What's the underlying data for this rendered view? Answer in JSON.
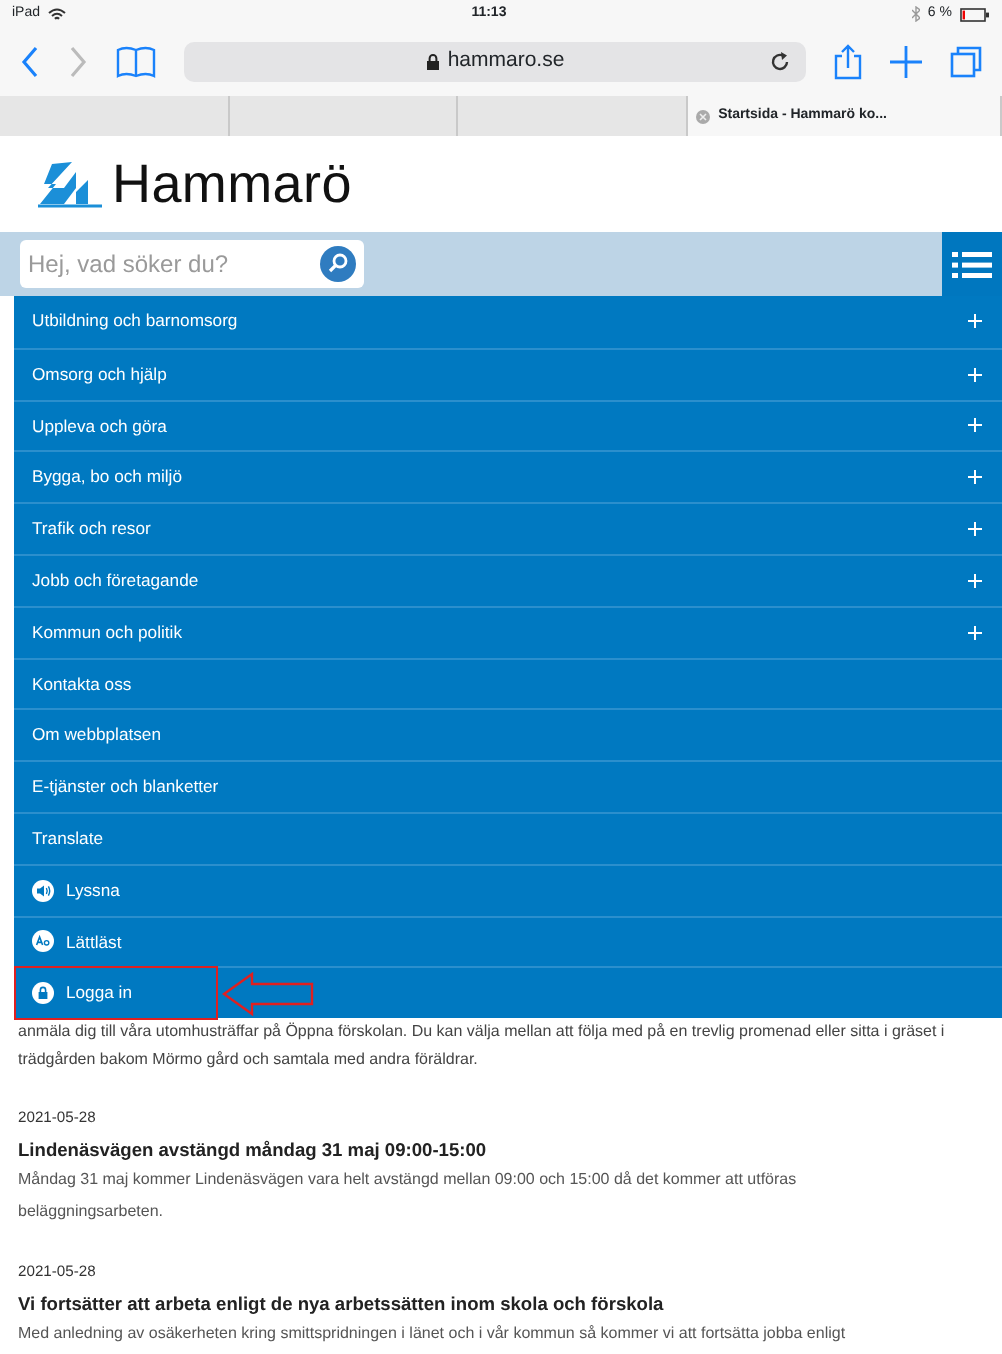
{
  "status_bar": {
    "device": "iPad",
    "time": "11:13",
    "battery": "6 %"
  },
  "browser": {
    "address": "hammaro.se",
    "tabs": [
      {
        "selected": false
      },
      {
        "selected": false
      },
      {
        "selected": false
      },
      {
        "title": "Startsida - Hammarö ko...",
        "selected": true
      }
    ]
  },
  "site": {
    "logo_text": "Hammarö",
    "search": {
      "placeholder": "Hej, vad söker du?"
    },
    "menu": [
      {
        "label": "Utbildning och barnomsorg",
        "kind": "section"
      },
      {
        "label": "Omsorg och hjälp",
        "kind": "section"
      },
      {
        "label": "Uppleva och göra",
        "kind": "section"
      },
      {
        "label": "Bygga, bo och miljö",
        "kind": "section"
      },
      {
        "label": "Trafik och resor",
        "kind": "section"
      },
      {
        "label": "Jobb och företagande",
        "kind": "section"
      },
      {
        "label": "Kommun och politik",
        "kind": "section"
      },
      {
        "label": "Kontakta oss",
        "kind": "link"
      },
      {
        "label": "Om webbplatsen",
        "kind": "link"
      },
      {
        "label": "E-tjänster och blanketter",
        "kind": "link"
      },
      {
        "label": "Translate",
        "kind": "link"
      },
      {
        "label": "Lyssna",
        "kind": "listen"
      },
      {
        "label": "Lättläst",
        "kind": "easyread"
      },
      {
        "label": "Logga in",
        "kind": "login",
        "highlighted": true
      }
    ]
  },
  "news_tail": [
    "anmäla dig till våra utomhusträffar på Öppna förskolan. Du kan välja mellan att följa med på en trevlig promenad eller sitta i gräset i trädgården bakom Mörmo gård och samtala med andra föräldrar."
  ],
  "news": [
    {
      "date": "2021-05-28",
      "title": "Lindenäsvägen avstängd måndag 31 maj 09:00-15:00",
      "text": "Måndag 31 maj kommer Lindenäsvägen vara helt avstängd mellan 09:00 och 15:00 då det kommer att utföras beläggningsarbeten."
    },
    {
      "date": "2021-05-28",
      "title": "Vi fortsätter att arbeta enligt de nya arbetssätten inom skola och förskola",
      "text": "Med anledning av osäkerheten kring smittspridningen i länet och i vår kommun så kommer vi att fortsätta jobba enligt"
    }
  ]
}
